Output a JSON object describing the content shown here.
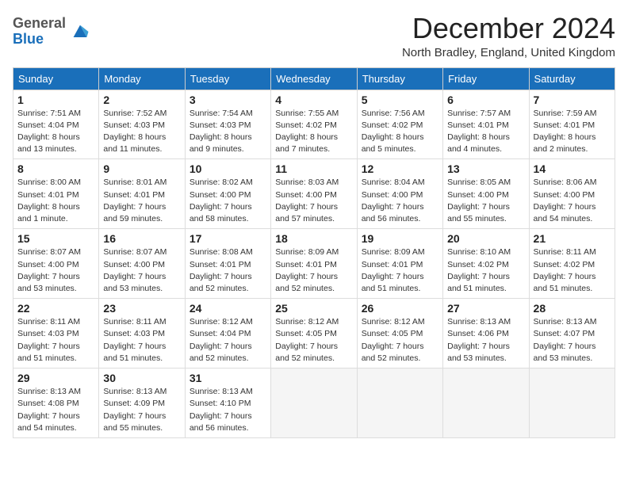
{
  "logo": {
    "text_general": "General",
    "text_blue": "Blue"
  },
  "title": "December 2024",
  "subtitle": "North Bradley, England, United Kingdom",
  "days_of_week": [
    "Sunday",
    "Monday",
    "Tuesday",
    "Wednesday",
    "Thursday",
    "Friday",
    "Saturday"
  ],
  "weeks": [
    [
      {
        "day": 1,
        "sunrise": "7:51 AM",
        "sunset": "4:04 PM",
        "daylight": "8 hours and 13 minutes."
      },
      {
        "day": 2,
        "sunrise": "7:52 AM",
        "sunset": "4:03 PM",
        "daylight": "8 hours and 11 minutes."
      },
      {
        "day": 3,
        "sunrise": "7:54 AM",
        "sunset": "4:03 PM",
        "daylight": "8 hours and 9 minutes."
      },
      {
        "day": 4,
        "sunrise": "7:55 AM",
        "sunset": "4:02 PM",
        "daylight": "8 hours and 7 minutes."
      },
      {
        "day": 5,
        "sunrise": "7:56 AM",
        "sunset": "4:02 PM",
        "daylight": "8 hours and 5 minutes."
      },
      {
        "day": 6,
        "sunrise": "7:57 AM",
        "sunset": "4:01 PM",
        "daylight": "8 hours and 4 minutes."
      },
      {
        "day": 7,
        "sunrise": "7:59 AM",
        "sunset": "4:01 PM",
        "daylight": "8 hours and 2 minutes."
      }
    ],
    [
      {
        "day": 8,
        "sunrise": "8:00 AM",
        "sunset": "4:01 PM",
        "daylight": "8 hours and 1 minute."
      },
      {
        "day": 9,
        "sunrise": "8:01 AM",
        "sunset": "4:01 PM",
        "daylight": "7 hours and 59 minutes."
      },
      {
        "day": 10,
        "sunrise": "8:02 AM",
        "sunset": "4:00 PM",
        "daylight": "7 hours and 58 minutes."
      },
      {
        "day": 11,
        "sunrise": "8:03 AM",
        "sunset": "4:00 PM",
        "daylight": "7 hours and 57 minutes."
      },
      {
        "day": 12,
        "sunrise": "8:04 AM",
        "sunset": "4:00 PM",
        "daylight": "7 hours and 56 minutes."
      },
      {
        "day": 13,
        "sunrise": "8:05 AM",
        "sunset": "4:00 PM",
        "daylight": "7 hours and 55 minutes."
      },
      {
        "day": 14,
        "sunrise": "8:06 AM",
        "sunset": "4:00 PM",
        "daylight": "7 hours and 54 minutes."
      }
    ],
    [
      {
        "day": 15,
        "sunrise": "8:07 AM",
        "sunset": "4:00 PM",
        "daylight": "7 hours and 53 minutes."
      },
      {
        "day": 16,
        "sunrise": "8:07 AM",
        "sunset": "4:00 PM",
        "daylight": "7 hours and 53 minutes."
      },
      {
        "day": 17,
        "sunrise": "8:08 AM",
        "sunset": "4:01 PM",
        "daylight": "7 hours and 52 minutes."
      },
      {
        "day": 18,
        "sunrise": "8:09 AM",
        "sunset": "4:01 PM",
        "daylight": "7 hours and 52 minutes."
      },
      {
        "day": 19,
        "sunrise": "8:09 AM",
        "sunset": "4:01 PM",
        "daylight": "7 hours and 51 minutes."
      },
      {
        "day": 20,
        "sunrise": "8:10 AM",
        "sunset": "4:02 PM",
        "daylight": "7 hours and 51 minutes."
      },
      {
        "day": 21,
        "sunrise": "8:11 AM",
        "sunset": "4:02 PM",
        "daylight": "7 hours and 51 minutes."
      }
    ],
    [
      {
        "day": 22,
        "sunrise": "8:11 AM",
        "sunset": "4:03 PM",
        "daylight": "7 hours and 51 minutes."
      },
      {
        "day": 23,
        "sunrise": "8:11 AM",
        "sunset": "4:03 PM",
        "daylight": "7 hours and 51 minutes."
      },
      {
        "day": 24,
        "sunrise": "8:12 AM",
        "sunset": "4:04 PM",
        "daylight": "7 hours and 52 minutes."
      },
      {
        "day": 25,
        "sunrise": "8:12 AM",
        "sunset": "4:05 PM",
        "daylight": "7 hours and 52 minutes."
      },
      {
        "day": 26,
        "sunrise": "8:12 AM",
        "sunset": "4:05 PM",
        "daylight": "7 hours and 52 minutes."
      },
      {
        "day": 27,
        "sunrise": "8:13 AM",
        "sunset": "4:06 PM",
        "daylight": "7 hours and 53 minutes."
      },
      {
        "day": 28,
        "sunrise": "8:13 AM",
        "sunset": "4:07 PM",
        "daylight": "7 hours and 53 minutes."
      }
    ],
    [
      {
        "day": 29,
        "sunrise": "8:13 AM",
        "sunset": "4:08 PM",
        "daylight": "7 hours and 54 minutes."
      },
      {
        "day": 30,
        "sunrise": "8:13 AM",
        "sunset": "4:09 PM",
        "daylight": "7 hours and 55 minutes."
      },
      {
        "day": 31,
        "sunrise": "8:13 AM",
        "sunset": "4:10 PM",
        "daylight": "7 hours and 56 minutes."
      },
      null,
      null,
      null,
      null
    ]
  ]
}
